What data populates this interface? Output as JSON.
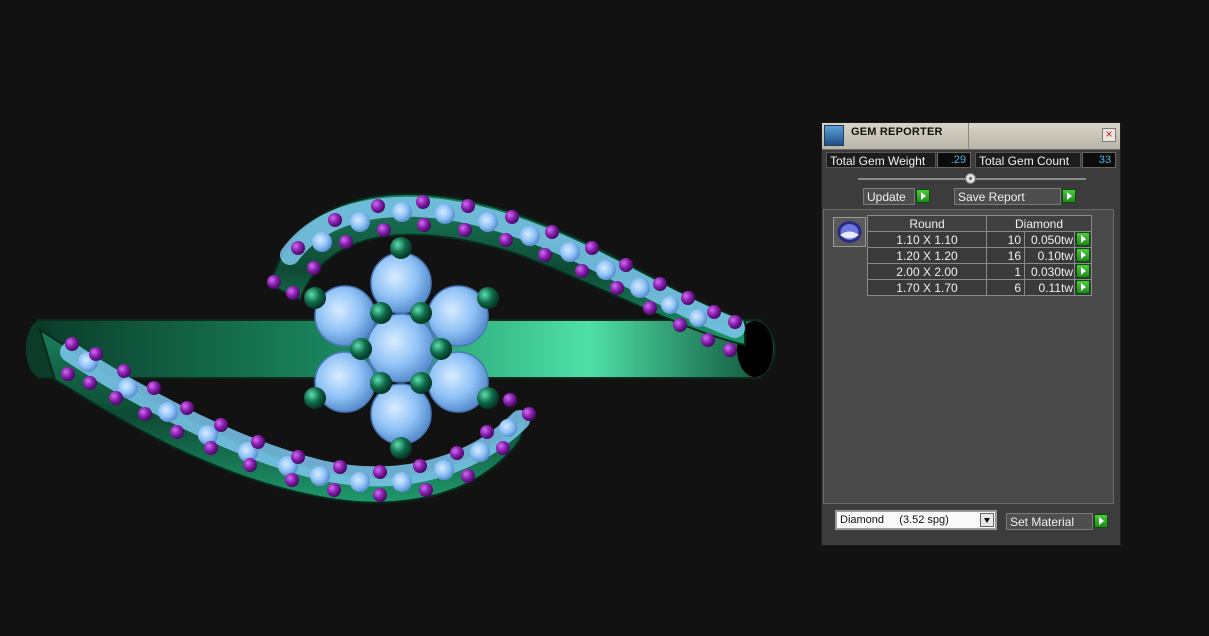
{
  "viewport": {
    "colors": {
      "background": "#121212",
      "metal_green": "#1c9a70",
      "diamond_blue": "#8fc2f6",
      "gem_purple": "#8a1fb0",
      "gem_green": "#0f6b4a"
    }
  },
  "panel": {
    "title": "GEM REPORTER",
    "close_icon": "close-icon",
    "total_weight_label": "Total Gem Weight",
    "total_weight_value": ".29",
    "total_count_label": "Total Gem Count",
    "total_count_value": "33",
    "slider_position": 0.5,
    "update_label": "Update",
    "save_report_label": "Save Report",
    "table": {
      "header_shape": "Round",
      "header_material": "Diamond",
      "rows": [
        {
          "size": "1.10 X 1.10",
          "count": "10",
          "weight": "0.050tw"
        },
        {
          "size": "1.20 X 1.20",
          "count": "16",
          "weight": "0.10tw"
        },
        {
          "size": "2.00 X 2.00",
          "count": "1",
          "weight": "0.030tw"
        },
        {
          "size": "1.70 X 1.70",
          "count": "6",
          "weight": "0.11tw"
        }
      ]
    },
    "material_select": "Diamond     (3.52 spg)",
    "set_material_label": "Set Material",
    "colors": {
      "accent_green": "#2fb02a",
      "value_blue": "#4fb0dc",
      "close_red": "#c62020"
    }
  }
}
